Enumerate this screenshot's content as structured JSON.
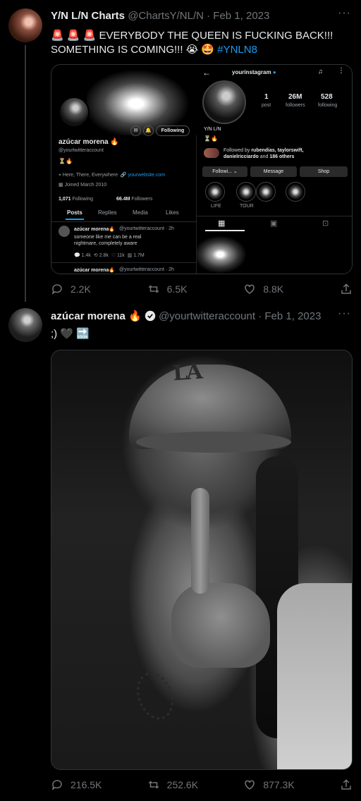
{
  "tweet1": {
    "author_name": "Y/N L/N Charts",
    "handle": "@ChartsY/NL/N",
    "sep": "·",
    "date": "Feb 1, 2023",
    "more": "···",
    "text_emoji": "🚨 🚨 🚨",
    "text_line1": "EVERYBODY THE QUEEN IS FUCKING BACK!!!",
    "text_line2": "SOMETHING IS COMING!!! 😭 🤩",
    "hashtag": "#YNLN8",
    "replies": "2.2K",
    "retweets": "6.5K",
    "likes": "8.8K"
  },
  "embed": {
    "twitter": {
      "name": "azúcar morena 🔥",
      "handle": "@yourtwitteraccount",
      "bio": "⏳🔥",
      "location": "Here, There, Everywhere",
      "website": "yourwebsite.com",
      "joined": "Joined March 2010",
      "following_count": "1,071",
      "following_label": "Following",
      "followers_count": "66.4M",
      "followers_label": "Followers",
      "follow_button": "Following",
      "tabs": [
        "Posts",
        "Replies",
        "Media",
        "Likes"
      ],
      "post_author": "azúcar morena🔥",
      "post_handle": "@yourtwitteraccount · 2h",
      "post_text": "someone like me can be a real nightmare, completely aware",
      "post_stats": [
        "1.4k",
        "2.8k",
        "11k",
        "1.7M"
      ],
      "post2_author": "azúcar morena🔥",
      "post2_handle": "@yourtwitteraccount · 2h"
    },
    "instagram": {
      "username": "yourinstagram",
      "posts_count": "1",
      "posts_label": "post",
      "followers_count": "26M",
      "followers_label": "followers",
      "following_count": "528",
      "following_label": "following",
      "display_name": "Y/N L/N",
      "bio": "⏳🔥",
      "followed_by_prefix": "Followed by",
      "followed_by_names": "rubendias, taylorswift,",
      "followed_by_names2": "danielricciardo",
      "followed_by_suffix": "and",
      "followed_by_others": "186 others",
      "btn_following": "Followi... ⌄",
      "btn_message": "Message",
      "btn_shop": "Shop",
      "highlights": [
        "LIFE",
        "TOUR"
      ]
    }
  },
  "tweet2": {
    "author_name": "azúcar morena 🔥",
    "handle": "@yourtwitteraccount",
    "sep": "·",
    "date": "Feb 1, 2023",
    "more": "···",
    "text": ";) 🖤 🔜",
    "photo_cap_logo": "LA",
    "replies": "216.5K",
    "retweets": "252.6K",
    "likes": "877.3K"
  },
  "colors": {
    "background": "#000000",
    "text": "#e7e9ea",
    "muted": "#71767b",
    "link": "#1d9bf0",
    "border": "#2f3336"
  }
}
